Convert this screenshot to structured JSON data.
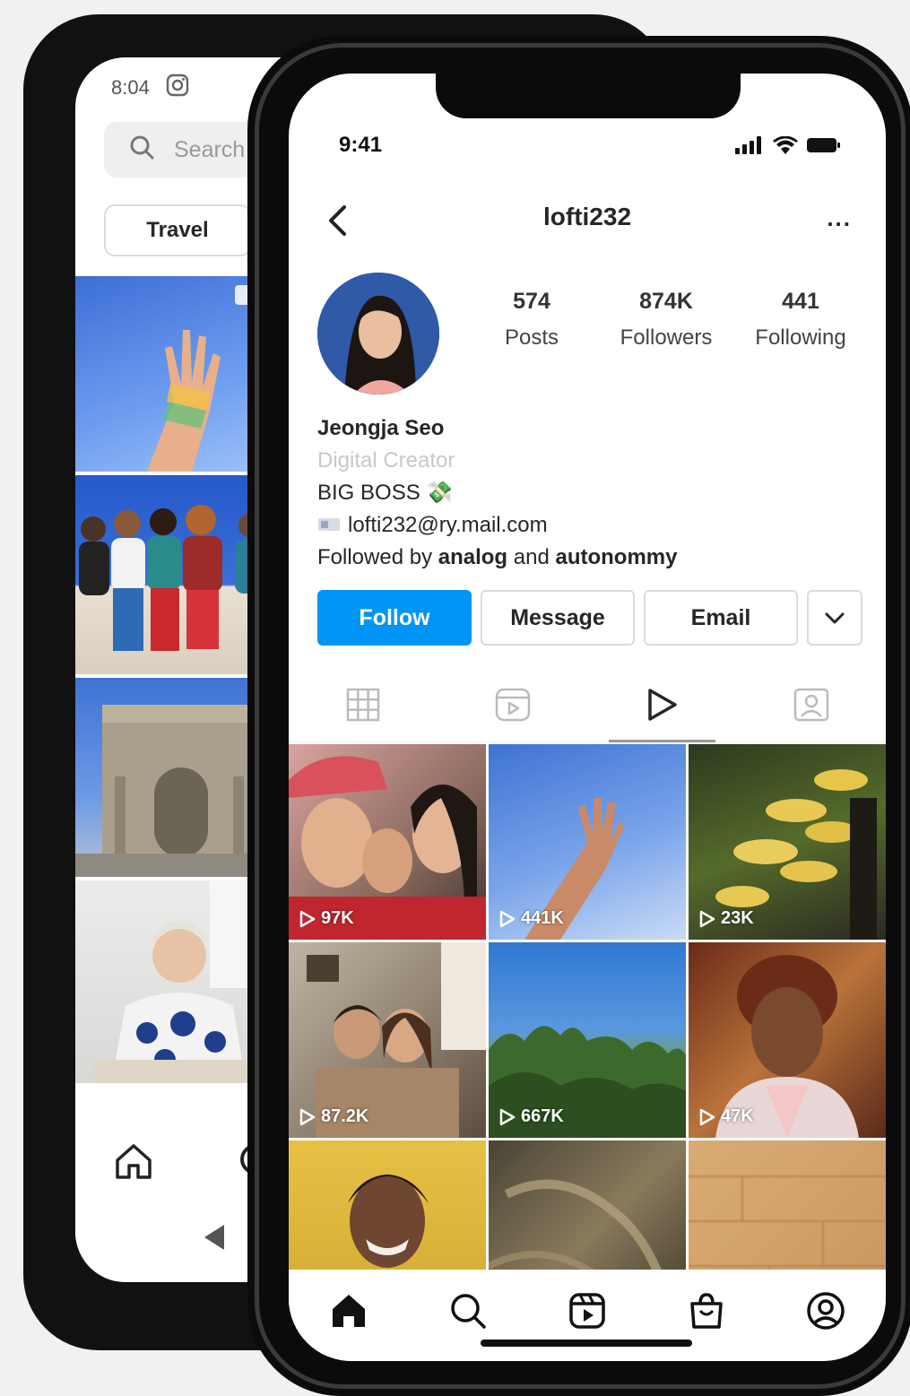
{
  "back_phone": {
    "status_time": "8:04",
    "search_placeholder": "Search",
    "chip_label": "Travel"
  },
  "front_phone": {
    "status_time": "9:41",
    "header": {
      "username": "lofti232",
      "more_label": "..."
    },
    "stats": [
      {
        "value": "574",
        "label": "Posts"
      },
      {
        "value": "874K",
        "label": "Followers"
      },
      {
        "value": "441",
        "label": "Following"
      }
    ],
    "bio": {
      "name": "Jeongja Seo",
      "category": "Digital Creator",
      "line1": "BIG BOSS 💸",
      "email_line": "lofti232@ry.mail.com",
      "followed_prefix": "Followed by ",
      "followed_user1": "analog",
      "followed_and": " and ",
      "followed_user2": "autonommy"
    },
    "actions": {
      "follow": "Follow",
      "message": "Message",
      "email": "Email"
    },
    "grid_views": [
      "97K",
      "441K",
      "23K",
      "87.2K",
      "667K",
      "47K"
    ],
    "colors": {
      "accent": "#0095f6"
    }
  }
}
